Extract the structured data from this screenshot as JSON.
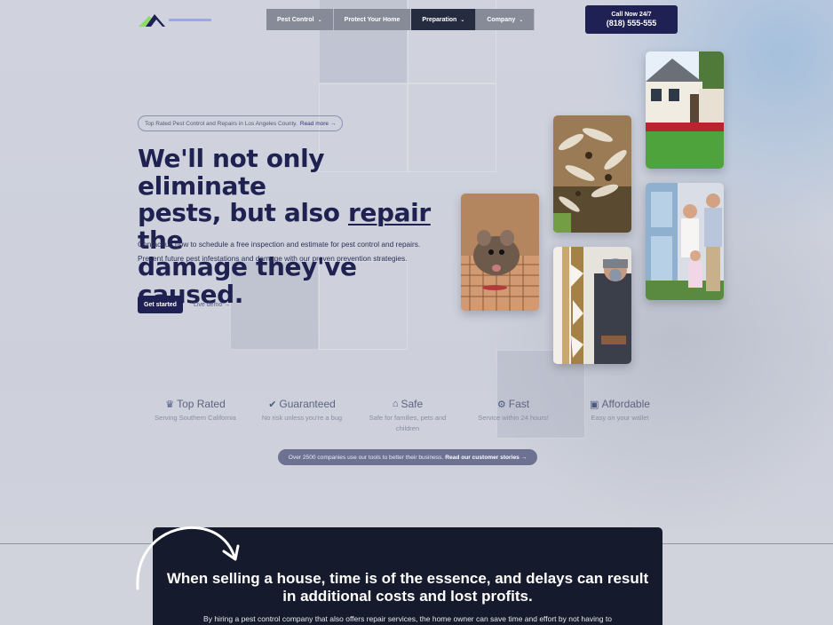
{
  "header": {
    "logo_alt": "logo",
    "nav": [
      {
        "label": "Pest Control",
        "has_dropdown": true
      },
      {
        "label": "Protect Your Home",
        "has_dropdown": false
      },
      {
        "label": "Preparation",
        "has_dropdown": true
      },
      {
        "label": "Company",
        "has_dropdown": true
      }
    ],
    "call": {
      "line1": "Call Now 24/7",
      "phone": "(818) 555-555"
    }
  },
  "hero": {
    "pill_text": "Top Rated Pest Control and Repairs in Los Angeles County.",
    "pill_link": "Read more →",
    "headline_1": "We'll not only eliminate",
    "headline_2a": "pests, but also ",
    "headline_2b": "repair",
    "headline_2c": " the",
    "headline_3": "damage they've caused.",
    "subtext": "Contact us now to schedule a free inspection and estimate for pest control and repairs. Prevent future pest infestations and damage with our proven prevention strategies.",
    "primary_button": "Get started",
    "secondary_link": "Live demo →"
  },
  "features": [
    {
      "icon": "top-rated-icon",
      "glyph": "♛",
      "title": "Top Rated",
      "desc": "Serving Southern California"
    },
    {
      "icon": "guaranteed-icon",
      "glyph": "✔",
      "title": "Guaranteed",
      "desc": "No risk unless you're a bug"
    },
    {
      "icon": "safe-icon",
      "glyph": "⌂",
      "title": "Safe",
      "desc": "Safe for families, pets and children"
    },
    {
      "icon": "fast-icon",
      "glyph": "⚙",
      "title": "Fast",
      "desc": "Service within 24 hours!"
    },
    {
      "icon": "affordable-icon",
      "glyph": "▣",
      "title": "Affordable",
      "desc": "Easy on your wallet"
    }
  ],
  "banner": {
    "text": "Over 2500 companies use our tools to better their business.",
    "link": "Read our customer stories →"
  },
  "section": {
    "title": "When selling a house, time is of the essence, and delays can result in additional costs and lost profits.",
    "text": "By hiring a pest control company that also offers repair services, the home owner can save time and effort by not having to"
  },
  "colors": {
    "brand_dark": "#1f2154",
    "nav_active": "#262c3f",
    "nav_default": "#878b98",
    "panel": "#151b2c"
  }
}
